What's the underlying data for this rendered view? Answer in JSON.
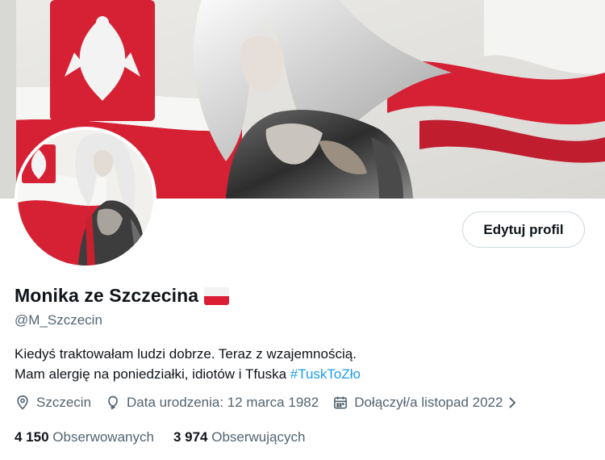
{
  "profile": {
    "display_name": "Monika ze Szczecina",
    "handle": "@M_Szczecin",
    "bio_line1": "Kiedyś traktowałam ludzi dobrze. Teraz z wzajemnością.",
    "bio_line2": "Mam alergię na poniedziałki, idiotów i Tfuska ",
    "bio_hashtag": "#TuskToZło",
    "location": "Szczecin",
    "birthdate": "Data urodzenia: 12 marca 1982",
    "joined": "Dołączył/a listopad 2022",
    "following_count": "4 150",
    "following_label": "Obserwowanych",
    "followers_count": "3 974",
    "followers_label": "Obserwujących"
  },
  "buttons": {
    "edit_profile": "Edytuj profil"
  },
  "icons": {
    "location": "location-pin-icon",
    "birthdate": "balloon-icon",
    "joined": "calendar-icon",
    "chevron": "chevron-right-icon",
    "flag": "poland-flag-emoji"
  },
  "colors": {
    "link": "#1d9bf0",
    "secondary_text": "#536471",
    "primary_text": "#0f1419",
    "flag_red": "#dc1e35"
  }
}
